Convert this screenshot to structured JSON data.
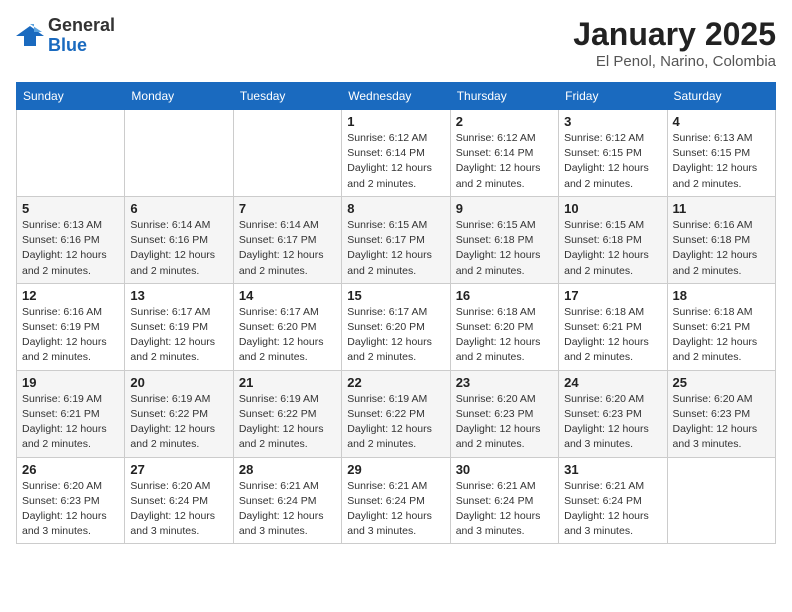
{
  "header": {
    "logo": {
      "general": "General",
      "blue": "Blue"
    },
    "title": "January 2025",
    "location": "El Penol, Narino, Colombia"
  },
  "calendar": {
    "days_of_week": [
      "Sunday",
      "Monday",
      "Tuesday",
      "Wednesday",
      "Thursday",
      "Friday",
      "Saturday"
    ],
    "weeks": [
      [
        {
          "day": "",
          "info": ""
        },
        {
          "day": "",
          "info": ""
        },
        {
          "day": "",
          "info": ""
        },
        {
          "day": "1",
          "info": "Sunrise: 6:12 AM\nSunset: 6:14 PM\nDaylight: 12 hours\nand 2 minutes."
        },
        {
          "day": "2",
          "info": "Sunrise: 6:12 AM\nSunset: 6:14 PM\nDaylight: 12 hours\nand 2 minutes."
        },
        {
          "day": "3",
          "info": "Sunrise: 6:12 AM\nSunset: 6:15 PM\nDaylight: 12 hours\nand 2 minutes."
        },
        {
          "day": "4",
          "info": "Sunrise: 6:13 AM\nSunset: 6:15 PM\nDaylight: 12 hours\nand 2 minutes."
        }
      ],
      [
        {
          "day": "5",
          "info": "Sunrise: 6:13 AM\nSunset: 6:16 PM\nDaylight: 12 hours\nand 2 minutes."
        },
        {
          "day": "6",
          "info": "Sunrise: 6:14 AM\nSunset: 6:16 PM\nDaylight: 12 hours\nand 2 minutes."
        },
        {
          "day": "7",
          "info": "Sunrise: 6:14 AM\nSunset: 6:17 PM\nDaylight: 12 hours\nand 2 minutes."
        },
        {
          "day": "8",
          "info": "Sunrise: 6:15 AM\nSunset: 6:17 PM\nDaylight: 12 hours\nand 2 minutes."
        },
        {
          "day": "9",
          "info": "Sunrise: 6:15 AM\nSunset: 6:18 PM\nDaylight: 12 hours\nand 2 minutes."
        },
        {
          "day": "10",
          "info": "Sunrise: 6:15 AM\nSunset: 6:18 PM\nDaylight: 12 hours\nand 2 minutes."
        },
        {
          "day": "11",
          "info": "Sunrise: 6:16 AM\nSunset: 6:18 PM\nDaylight: 12 hours\nand 2 minutes."
        }
      ],
      [
        {
          "day": "12",
          "info": "Sunrise: 6:16 AM\nSunset: 6:19 PM\nDaylight: 12 hours\nand 2 minutes."
        },
        {
          "day": "13",
          "info": "Sunrise: 6:17 AM\nSunset: 6:19 PM\nDaylight: 12 hours\nand 2 minutes."
        },
        {
          "day": "14",
          "info": "Sunrise: 6:17 AM\nSunset: 6:20 PM\nDaylight: 12 hours\nand 2 minutes."
        },
        {
          "day": "15",
          "info": "Sunrise: 6:17 AM\nSunset: 6:20 PM\nDaylight: 12 hours\nand 2 minutes."
        },
        {
          "day": "16",
          "info": "Sunrise: 6:18 AM\nSunset: 6:20 PM\nDaylight: 12 hours\nand 2 minutes."
        },
        {
          "day": "17",
          "info": "Sunrise: 6:18 AM\nSunset: 6:21 PM\nDaylight: 12 hours\nand 2 minutes."
        },
        {
          "day": "18",
          "info": "Sunrise: 6:18 AM\nSunset: 6:21 PM\nDaylight: 12 hours\nand 2 minutes."
        }
      ],
      [
        {
          "day": "19",
          "info": "Sunrise: 6:19 AM\nSunset: 6:21 PM\nDaylight: 12 hours\nand 2 minutes."
        },
        {
          "day": "20",
          "info": "Sunrise: 6:19 AM\nSunset: 6:22 PM\nDaylight: 12 hours\nand 2 minutes."
        },
        {
          "day": "21",
          "info": "Sunrise: 6:19 AM\nSunset: 6:22 PM\nDaylight: 12 hours\nand 2 minutes."
        },
        {
          "day": "22",
          "info": "Sunrise: 6:19 AM\nSunset: 6:22 PM\nDaylight: 12 hours\nand 2 minutes."
        },
        {
          "day": "23",
          "info": "Sunrise: 6:20 AM\nSunset: 6:23 PM\nDaylight: 12 hours\nand 2 minutes."
        },
        {
          "day": "24",
          "info": "Sunrise: 6:20 AM\nSunset: 6:23 PM\nDaylight: 12 hours\nand 3 minutes."
        },
        {
          "day": "25",
          "info": "Sunrise: 6:20 AM\nSunset: 6:23 PM\nDaylight: 12 hours\nand 3 minutes."
        }
      ],
      [
        {
          "day": "26",
          "info": "Sunrise: 6:20 AM\nSunset: 6:23 PM\nDaylight: 12 hours\nand 3 minutes."
        },
        {
          "day": "27",
          "info": "Sunrise: 6:20 AM\nSunset: 6:24 PM\nDaylight: 12 hours\nand 3 minutes."
        },
        {
          "day": "28",
          "info": "Sunrise: 6:21 AM\nSunset: 6:24 PM\nDaylight: 12 hours\nand 3 minutes."
        },
        {
          "day": "29",
          "info": "Sunrise: 6:21 AM\nSunset: 6:24 PM\nDaylight: 12 hours\nand 3 minutes."
        },
        {
          "day": "30",
          "info": "Sunrise: 6:21 AM\nSunset: 6:24 PM\nDaylight: 12 hours\nand 3 minutes."
        },
        {
          "day": "31",
          "info": "Sunrise: 6:21 AM\nSunset: 6:24 PM\nDaylight: 12 hours\nand 3 minutes."
        },
        {
          "day": "",
          "info": ""
        }
      ]
    ]
  }
}
